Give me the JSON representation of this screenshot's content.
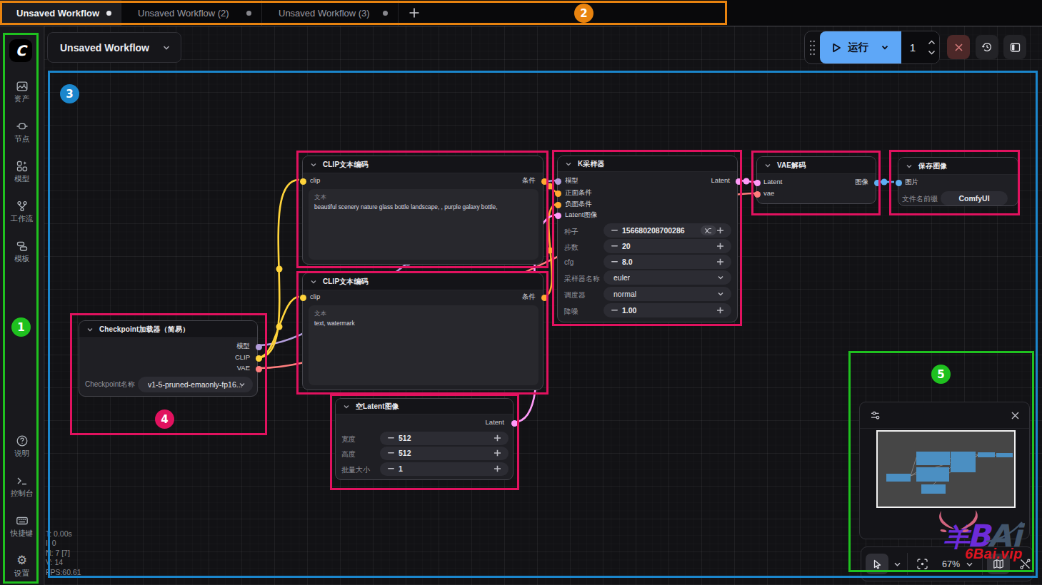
{
  "palette": {
    "annotation_green": "#1FC11F",
    "annotation_orange": "#E8830F",
    "annotation_blue": "#1B86CC",
    "annotation_pink": "#E1125F",
    "run_blue": "#5EA7F7",
    "link_model": "#B39DDB",
    "link_clip": "#FFD43B",
    "link_vae": "#FF7E7E",
    "link_conditioning": "#FFA931",
    "link_latent": "#FF9CF9",
    "link_image": "#5FAEF2",
    "minimap_node_blue": "#4B8FC2"
  },
  "tab_bar": {
    "tabs": [
      {
        "label": "Unsaved Workflow",
        "active": true
      },
      {
        "label": "Unsaved Workflow (2)",
        "active": false
      },
      {
        "label": "Unsaved Workflow (3)",
        "active": false
      }
    ],
    "new_tab_label": "+"
  },
  "workflow_menu": {
    "label": "Unsaved Workflow"
  },
  "logo": {
    "glyph": "C"
  },
  "icons": {
    "gear": "⚙"
  },
  "run_controls": {
    "run_label": "运行",
    "batch_count": "1"
  },
  "sidebar": {
    "items": [
      {
        "label": "资产"
      },
      {
        "label": "节点"
      },
      {
        "label": "模型"
      },
      {
        "label": "工作流"
      },
      {
        "label": "模板"
      }
    ],
    "bottom_items": [
      {
        "label": "说明"
      },
      {
        "label": "控制台"
      },
      {
        "label": "快捷键"
      },
      {
        "label": "设置"
      }
    ]
  },
  "nodes": {
    "checkpoint": {
      "title": "Checkpoint加载器（简易）",
      "outputs": [
        "模型",
        "CLIP",
        "VAE"
      ],
      "widgets": [
        {
          "label": "Checkpoint名称",
          "value": "v1-5-pruned-emaonly-fp16..."
        }
      ]
    },
    "clip_positive": {
      "title": "CLIP文本编码",
      "inputs": [
        "clip"
      ],
      "outputs": [
        "条件"
      ],
      "text_label": "文本",
      "text": "beautiful scenery nature glass bottle landscape, , purple galaxy bottle,"
    },
    "clip_negative": {
      "title": "CLIP文本编码",
      "inputs": [
        "clip"
      ],
      "outputs": [
        "条件"
      ],
      "text_label": "文本",
      "text": "text, watermark"
    },
    "empty_latent": {
      "title": "空Latent图像",
      "outputs": [
        "Latent"
      ],
      "widgets": [
        {
          "label": "宽度",
          "value": "512"
        },
        {
          "label": "高度",
          "value": "512"
        },
        {
          "label": "批量大小",
          "value": "1"
        }
      ]
    },
    "ksampler": {
      "title": "K采样器",
      "inputs": [
        "模型",
        "正面条件",
        "负面条件",
        "Latent图像"
      ],
      "outputs": [
        "Latent"
      ],
      "widgets": [
        {
          "label": "种子",
          "value": "156680208700286"
        },
        {
          "label": "步数",
          "value": "20"
        },
        {
          "label": "cfg",
          "value": "8.0"
        },
        {
          "label": "采样器名称",
          "value": "euler"
        },
        {
          "label": "调度器",
          "value": "normal"
        },
        {
          "label": "降噪",
          "value": "1.00"
        }
      ]
    },
    "vae_decode": {
      "title": "VAE解码",
      "inputs": [
        "Latent",
        "vae"
      ],
      "outputs": [
        "图像"
      ]
    },
    "save_image": {
      "title": "保存图像",
      "inputs": [
        "图片"
      ],
      "widgets": [
        {
          "label": "文件名前缀",
          "value": "ComfyUI"
        }
      ]
    }
  },
  "stats": {
    "lines": [
      "T: 0.00s",
      "I: 0",
      "N: 7 [7]",
      "V: 14",
      "FPS:60.61"
    ]
  },
  "minimap_toolbar": {
    "zoom": "67%"
  },
  "watermark": {
    "glyph": "羊",
    "letter_b": "B",
    "letters_ai": "Ai",
    "site": "6Bai.vip"
  },
  "annotations": {
    "labels": [
      "1",
      "2",
      "3",
      "4",
      "5"
    ]
  }
}
